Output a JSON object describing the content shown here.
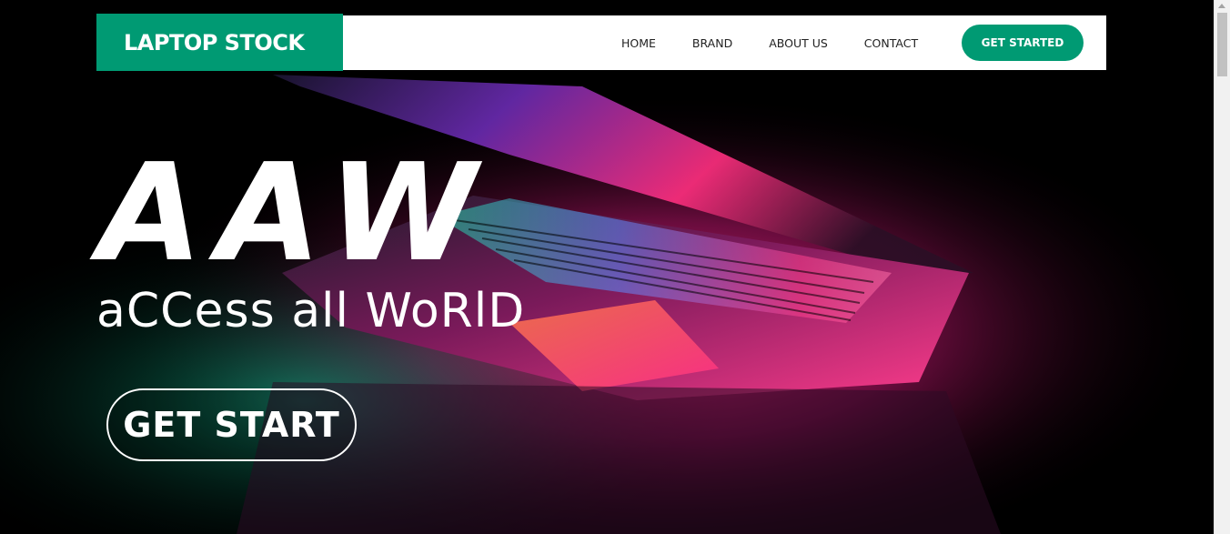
{
  "brand": {
    "label": "LAPTOP STOCK"
  },
  "nav": {
    "items": [
      {
        "label": "HOME"
      },
      {
        "label": "BRAND"
      },
      {
        "label": "ABOUT US"
      },
      {
        "label": "CONTACT"
      }
    ],
    "cta_label": "GET STARTED"
  },
  "hero": {
    "title": "AAW",
    "subtitle": "aCCess all WoRlD",
    "button_label": "GET START",
    "image_icon": "laptop-photo"
  },
  "colors": {
    "accent": "#009a73",
    "background": "#000000",
    "nav_background": "#ffffff"
  }
}
